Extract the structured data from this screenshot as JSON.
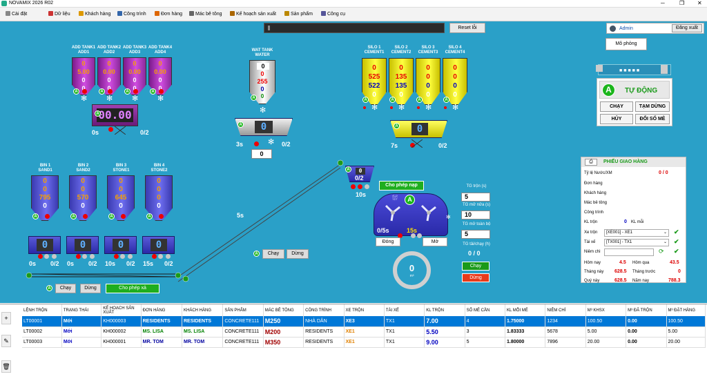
{
  "app_title": "NOVAMIX 2026 R02",
  "menu": [
    "Cài đặt",
    "Dữ liệu",
    "Khách hàng",
    "Công trình",
    "Đơn hàng",
    "Mác bê tông",
    "Kế hoạch sản xuất",
    "Sản phẩm",
    "Công cụ"
  ],
  "top": {
    "reset": "Reset lỗi",
    "user": "Admin",
    "logout": "Đăng xuất",
    "simulate": "Mô phỏng"
  },
  "add_tanks": [
    {
      "name": "ADD TANK1",
      "code": "ADD1",
      "v1": "0",
      "v2": "5.00",
      "v3": "0",
      "v4": "0"
    },
    {
      "name": "ADD TANK2",
      "code": "ADD2",
      "v1": "0",
      "v2": "0.00",
      "v3": "0",
      "v4": "0"
    },
    {
      "name": "ADD TANK3",
      "code": "ADD3",
      "v1": "0",
      "v2": "0.00",
      "v3": "0",
      "v4": "0"
    },
    {
      "name": "ADD TANK4",
      "code": "ADD4",
      "v1": "0",
      "v2": "0.00",
      "v3": "0",
      "v4": "0"
    }
  ],
  "add_scale": {
    "display": "00.00",
    "time": "0s",
    "count": "0/2"
  },
  "water": {
    "name": "WAT TANK",
    "code": "WATER",
    "v1": "0",
    "v2": "0",
    "v3": "255",
    "v4": "0",
    "v5": "0",
    "scale": "0",
    "time": "3s",
    "count": "0/2",
    "box": "0"
  },
  "silos": [
    {
      "name": "SILO 1",
      "code": "CEMENT1",
      "v1": "0",
      "v2": "525",
      "v3": "522",
      "v4": "0"
    },
    {
      "name": "SILO 2",
      "code": "CEMENT2",
      "v1": "0",
      "v2": "135",
      "v3": "135",
      "v4": "0"
    },
    {
      "name": "SILO 3",
      "code": "CEMENT3",
      "v1": "0",
      "v2": "0",
      "v3": "0",
      "v4": "0"
    },
    {
      "name": "SILO 4",
      "code": "CEMENT4",
      "v1": "0",
      "v2": "0",
      "v3": "0",
      "v4": "0"
    }
  ],
  "cement_scale": {
    "display": "0",
    "time": "7s",
    "count": "0/2"
  },
  "bins": [
    {
      "name": "BIN 1",
      "code": "SAND1",
      "v1": "0",
      "v2": "0",
      "v3": "795",
      "v4": "0",
      "scale": "0",
      "time": "0s",
      "count": "0/2"
    },
    {
      "name": "BIN 2",
      "code": "SAND2",
      "v1": "0",
      "v2": "0",
      "v3": "570",
      "v4": "0",
      "scale": "0",
      "time": "0s",
      "count": "0/2"
    },
    {
      "name": "BIN 3",
      "code": "STONE1",
      "v1": "0",
      "v2": "0",
      "v3": "645",
      "v4": "0",
      "scale": "0",
      "time": "10s",
      "count": "0/2"
    },
    {
      "name": "BIN 4",
      "code": "STONE2",
      "v1": "0",
      "v2": "0",
      "v3": "0",
      "v4": "0",
      "scale": "0",
      "time": "15s",
      "count": "0/2"
    }
  ],
  "conveyor": {
    "time": "5s",
    "run": "Chạy",
    "stop": "Dừng",
    "allow_discharge": "Cho phép xả"
  },
  "belt_btns": {
    "run": "Chạy",
    "stop": "Dừng"
  },
  "mixer": {
    "small_display": "0",
    "small_count": "0/2",
    "small_time": "10s",
    "allow_load": "Cho phép nạp",
    "time1": "0/5s",
    "time2": "15s",
    "close": "Đóng",
    "open": "Mở",
    "gauge": "0",
    "gauge_unit": "m³"
  },
  "mix_params": {
    "mix_time_label": "TG trộn (s)",
    "mix_time": "5",
    "half_open_label": "TG mở nửa (s)",
    "half_open": "10",
    "full_open_label": "TG mở toàn bộ",
    "full_open": "5",
    "trip_label": "TG tải/chạy (h)",
    "trip": "0 / 0",
    "run": "Chạy",
    "stop": "Dừng"
  },
  "auto_panel": {
    "badge": "A",
    "mode": "TỰ ĐỘNG",
    "run": "CHẠY",
    "pause": "TẠM DỪNG",
    "cancel": "HỦY",
    "change": "ĐỔI SỐ MẺ"
  },
  "ticket": {
    "title": "PHIẾU GIAO HÀNG",
    "ratio_label": "Tỷ lệ Nước/XM",
    "ratio": "0 / 0",
    "order": "Đơn hàng",
    "customer": "Khách hàng",
    "grade": "Mác bê tông",
    "site": "Công trình",
    "kl_tron": "KL trộn",
    "kl_val": "0",
    "kl_moi": "KL mỗi",
    "truck_label": "Xe trộn",
    "truck": "[XE001] - XE1",
    "driver_label": "Tài xế",
    "driver": "[TX001] - TX1",
    "seal_label": "Niêm chì",
    "today_label": "Hôm nay",
    "today": "4.5",
    "yesterday_label": "Hôm qua",
    "yesterday": "43.5",
    "month_label": "Tháng này",
    "month": "628.5",
    "last_month_label": "Tháng trước",
    "last_month": "0",
    "quarter_label": "Quý này",
    "quarter": "628.5",
    "year_label": "Năm nay",
    "year": "788.3"
  },
  "table": {
    "headers": [
      "LỆNH TRỘN",
      "TRẠNG THÁI",
      "KẾ HOẠCH SẢN XUẤT",
      "ĐƠN HÀNG",
      "KHÁCH HÀNG",
      "SẢN PHẨM",
      "MÁC BÊ TÔNG",
      "CÔNG TRÌNH",
      "XE TRỘN",
      "TÀI XẾ",
      "KL TRỘN",
      "SỐ MẺ CẦN",
      "KL MỖI MẺ",
      "NIÊM CHÌ",
      "M³ KHSX",
      "M³ ĐÃ TRỘN",
      "M³ ĐẶT HÀNG"
    ],
    "rows": [
      [
        "LT00001",
        "Mới",
        "KH000003",
        "RESIDENTS",
        "RESIDENTS",
        "CONCRETE111",
        "M250",
        "NHÀ DÂN",
        "XE3",
        "TX1",
        "7.00",
        "4",
        "1.75000",
        "1234",
        "100.50",
        "0.00",
        "100.50"
      ],
      [
        "LT00002",
        "Mới",
        "KH000002",
        "MS. LISA",
        "MS. LISA",
        "CONCRETE111",
        "M200",
        "RESIDENTS",
        "XE1",
        "TX1",
        "5.50",
        "3",
        "1.83333",
        "5678",
        "5.00",
        "0.00",
        "5.00"
      ],
      [
        "LT00003",
        "Mới",
        "KH000001",
        "MR. TOM",
        "MR. TOM",
        "CONCRETE111",
        "M350",
        "RESIDENTS",
        "XE1",
        "TX1",
        "9.00",
        "5",
        "1.80000",
        "7896",
        "20.00",
        "0.00",
        "20.00"
      ]
    ]
  }
}
